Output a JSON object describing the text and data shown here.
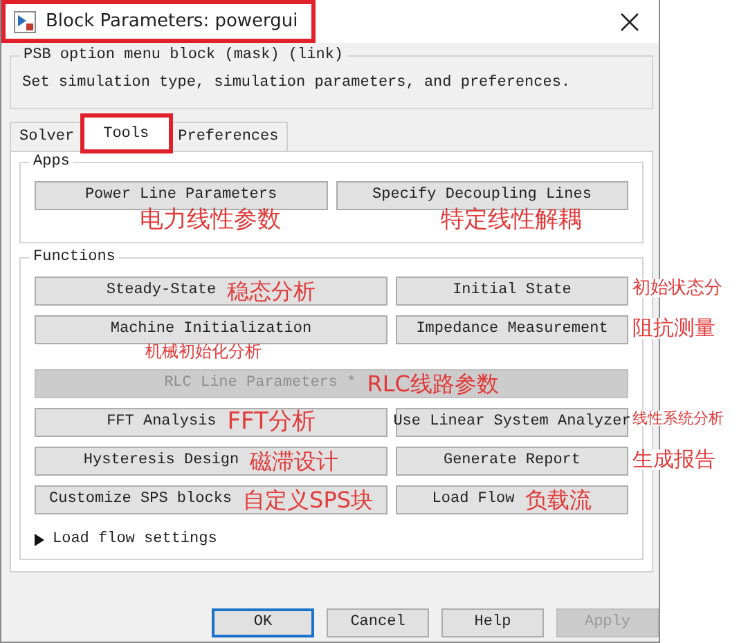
{
  "window": {
    "title": "Block Parameters: powergui",
    "title_highlighted": true
  },
  "mask": {
    "title": "PSB option menu block (mask) (link)",
    "description": "Set simulation type, simulation parameters, and preferences."
  },
  "tabs": [
    {
      "label": "Solver",
      "selected": false,
      "highlighted": false
    },
    {
      "label": "Tools",
      "selected": true,
      "highlighted": true
    },
    {
      "label": "Preferences",
      "selected": false,
      "highlighted": false
    }
  ],
  "apps": {
    "title": "Apps",
    "buttons": [
      {
        "label": "Power Line Parameters",
        "kind": "half",
        "disabled": false,
        "annotation": {
          "text": "电力线性参数",
          "kind": "below"
        }
      },
      {
        "label": "Specify Decoupling Lines",
        "kind": "half",
        "disabled": false,
        "annotation": {
          "text": "特定线性解耦",
          "kind": "below"
        }
      }
    ]
  },
  "functions": {
    "title": "Functions",
    "buttons": [
      {
        "label": "Steady-State",
        "kind": "half",
        "disabled": false,
        "annotation": {
          "text": "稳态分析",
          "kind": "inline"
        }
      },
      {
        "label": "Initial State",
        "kind": "half",
        "disabled": false,
        "annotation": {
          "text": "初始状态分",
          "kind": "outside"
        }
      },
      {
        "label": "Machine Initialization",
        "kind": "half",
        "disabled": false,
        "annotation": {
          "text": "机械初始化分析",
          "kind": "below"
        }
      },
      {
        "label": "Impedance Measurement",
        "kind": "half",
        "disabled": false,
        "annotation": {
          "text": "阻抗测量",
          "kind": "outside"
        }
      },
      {
        "label": "RLC Line Parameters *",
        "kind": "wide",
        "disabled": true,
        "annotation": {
          "text": "RLC线路参数",
          "kind": "inline"
        }
      },
      {
        "label": "FFT Analysis",
        "kind": "half",
        "disabled": false,
        "annotation": {
          "text": "FFT分析",
          "kind": "inline"
        }
      },
      {
        "label": "Use Linear System Analyzer",
        "kind": "half",
        "disabled": false,
        "annotation": {
          "text": "线性系统分析",
          "kind": "outside"
        }
      },
      {
        "label": "Hysteresis Design",
        "kind": "half",
        "disabled": false,
        "annotation": {
          "text": "磁滞设计",
          "kind": "inline"
        }
      },
      {
        "label": "Generate Report",
        "kind": "half",
        "disabled": false,
        "annotation": {
          "text": "生成报告",
          "kind": "outside"
        }
      },
      {
        "label": "Customize SPS blocks",
        "kind": "half",
        "disabled": false,
        "annotation": {
          "text": "自定义SPS块",
          "kind": "inline"
        }
      },
      {
        "label": "Load Flow",
        "kind": "half",
        "disabled": false,
        "annotation": {
          "text": "负载流",
          "kind": "inline"
        }
      }
    ]
  },
  "load_flow_settings": {
    "label": "Load flow settings",
    "expanded": false
  },
  "footer_buttons": [
    {
      "label": "OK",
      "default": true,
      "disabled": false
    },
    {
      "label": "Cancel",
      "default": false,
      "disabled": false
    },
    {
      "label": "Help",
      "default": false,
      "disabled": false
    },
    {
      "label": "Apply",
      "default": false,
      "disabled": true
    }
  ]
}
